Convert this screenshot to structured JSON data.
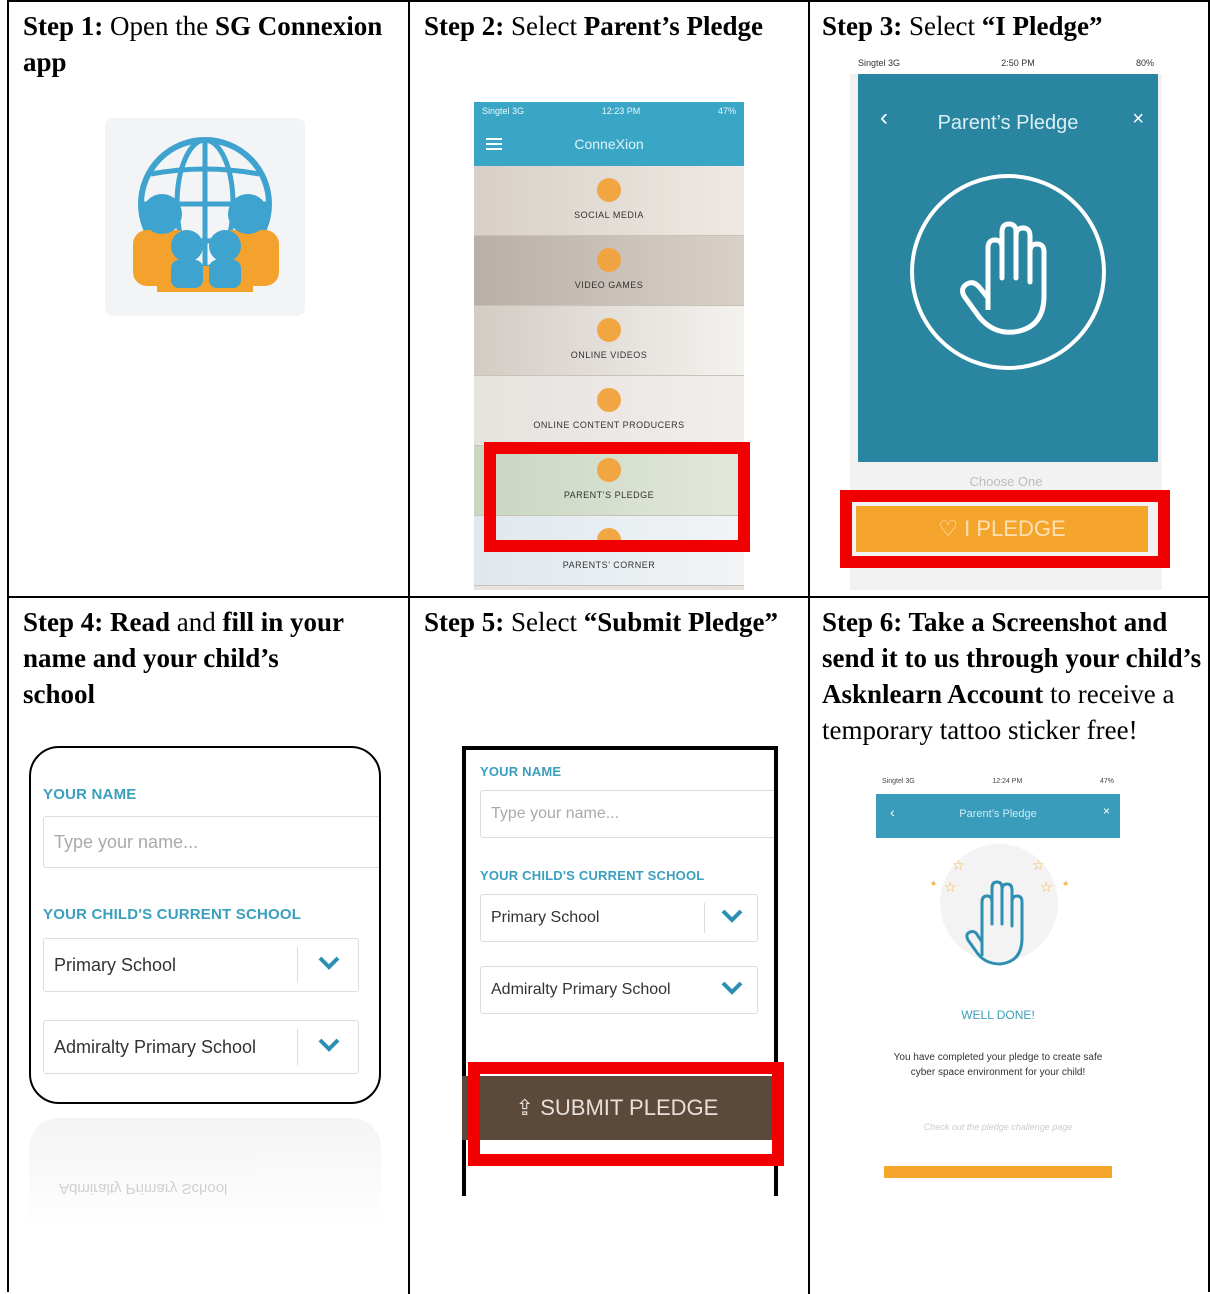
{
  "steps": [
    {
      "num": "Step 1:",
      "text_1": " Open the ",
      "bold_1": "SG Connexion app"
    },
    {
      "num": "Step 2:",
      "text_1": " Select ",
      "bold_1": "Parent’s Pledge",
      "phone": {
        "status_left": "Singtel 3G",
        "status_time": "12:23 PM",
        "status_right": "47%",
        "title": "ConneXion",
        "items": [
          "SOCIAL MEDIA",
          "VIDEO GAMES",
          "ONLINE VIDEOS",
          "ONLINE CONTENT PRODUCERS",
          "PARENT’S PLEDGE",
          "PARENTS’ CORNER"
        ]
      }
    },
    {
      "num": "Step 3:",
      "text_1": " Select ",
      "bold_1": "“I Pledge”",
      "phone": {
        "status_left": "Singtel 3G",
        "status_time": "2:50 PM",
        "status_right": "80%",
        "title": "Parent’s Pledge",
        "close": "×",
        "choose": "Choose One",
        "button": "♡  I PLEDGE"
      }
    },
    {
      "num": "Step 4:",
      "bold_1": "Read",
      "text_1": " and ",
      "bold_2": "fill in your name and your child’s school",
      "form": {
        "name_label": "YOUR NAME",
        "name_placeholder": "Type your name...",
        "school_label": "YOUR CHILD'S CURRENT SCHOOL",
        "level": "Primary School",
        "school": "Admiralty Primary School"
      }
    },
    {
      "num": "Step 5:",
      "text_1": " Select ",
      "bold_1": "“Submit Pledge”",
      "form": {
        "name_label": "YOUR NAME",
        "name_placeholder": "Type your name...",
        "school_label": "YOUR CHILD'S CURRENT SCHOOL",
        "level": "Primary School",
        "school": "Admiralty Primary School",
        "submit": "SUBMIT PLEDGE"
      }
    },
    {
      "num": "Step 6:",
      "bold_1": "  Take a Screenshot and send it to us through your child’s Asknlearn Account",
      "text_1": " to receive a temporary tattoo sticker free!",
      "phone": {
        "status_left": "Singtel 3G",
        "status_time": "12:24 PM",
        "status_right": "47%",
        "title": "Parent’s Pledge",
        "close": "×",
        "well_done": "WELL DONE!",
        "message": "You have completed your pledge to create safe cyber space environment for your child!",
        "link": "Check out the pledge challenge page"
      }
    }
  ],
  "colors": {
    "highlight": "#f00000",
    "teal": "#3aa6c6",
    "orange": "#f5a52c",
    "submit_brown": "#5b4a3a"
  }
}
